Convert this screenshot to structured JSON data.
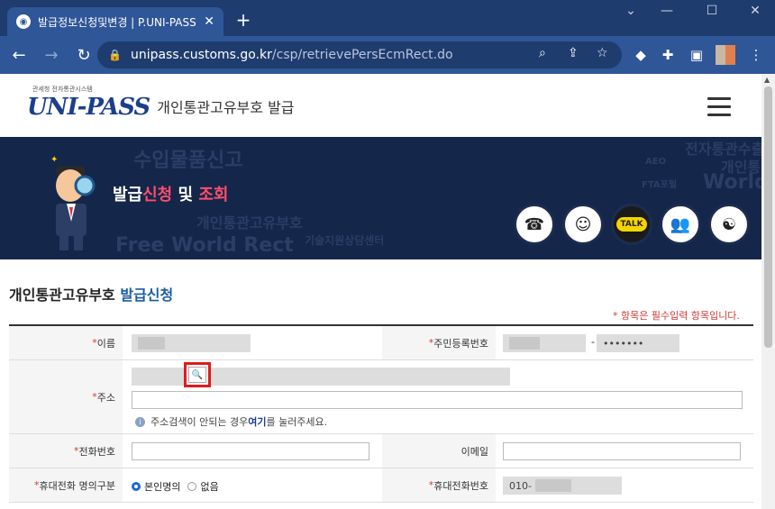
{
  "browser": {
    "tab_title": "발급정보신청및변경 | P.UNI-PASS",
    "url_host": "unipass.customs.go.kr",
    "url_path": "/csp/retrievePersEcmRect.do"
  },
  "site": {
    "logo_text": "UNI-PASS",
    "logo_small": "관세청 전자통관시스템",
    "header_title": "개인통관고유부호 발급",
    "banner_title_prefix": "발급",
    "banner_title_hl1": "신청",
    "banner_title_mid": " 및 ",
    "banner_title_hl2": "조회",
    "banner_icons": [
      "phone-icon",
      "mascot-icon",
      "talk-icon",
      "consult-icon",
      "gov-emblem-icon"
    ],
    "talk_label": "TALK",
    "banner_bg_words": [
      "수입물품신고",
      "전자통관수출",
      "개인통",
      "World",
      "FTA포털",
      "Free World Rect",
      "개인통관고유부호",
      "기술지원상담센터",
      "AEO"
    ]
  },
  "page": {
    "title_black": "개인통관고유부호",
    "title_blue": "발급신청",
    "required_note": "* 항목은 필수입력 항목입니다."
  },
  "form": {
    "name_label": "이름",
    "rrn_label": "주민등록번호",
    "rrn_sep": "-",
    "rrn_back": "•••••••",
    "address_label": "주소",
    "address_info_pre": "주소검색이 안되는 경우 ",
    "address_info_link": "여기",
    "address_info_post": "를 눌러주세요.",
    "phone_label": "전화번호",
    "email_label": "이메일",
    "mobile_type_label": "휴대전화 명의구분",
    "mobile_type_options": [
      "본인명의",
      "없음"
    ],
    "mobile_label": "휴대전화번호",
    "mobile_value": "010-"
  }
}
